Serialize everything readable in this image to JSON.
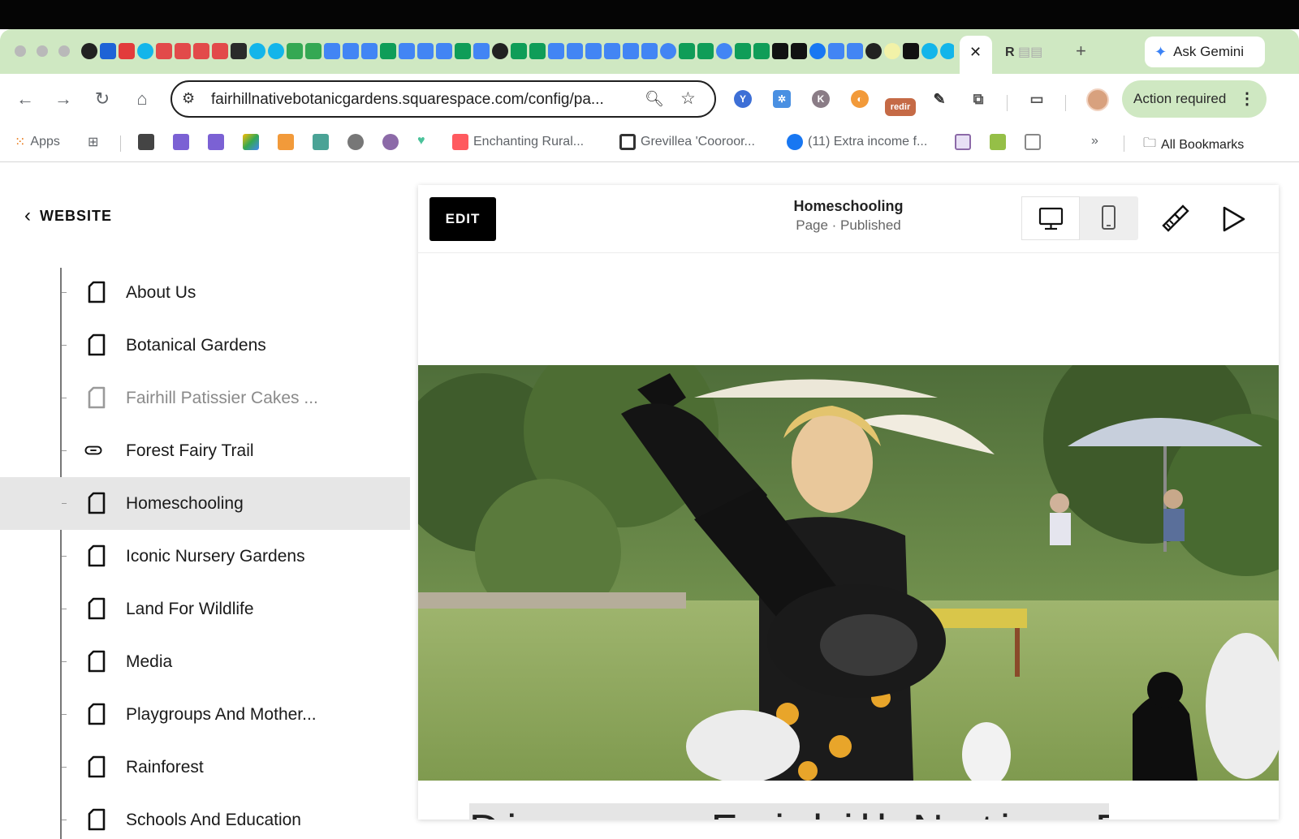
{
  "browser": {
    "address_url": "fairhillnativebotanicgardens.squarespace.com/config/pa...",
    "gemini_label": "Ask Gemini",
    "action_required_label": "Action required",
    "other_tab_label": "R",
    "bookmarks": {
      "apps_label": "Apps",
      "items": [
        "Enchanting Rural...",
        "Grevillea 'Cooroor...",
        "(11) Extra income f..."
      ],
      "all_bookmarks_label": "All Bookmarks"
    },
    "ext_redir_label": "redir"
  },
  "sidebar": {
    "back_label": "WEBSITE",
    "pages": [
      {
        "label": "About Us",
        "icon": "page-icon"
      },
      {
        "label": "Botanical Gardens",
        "icon": "page-icon"
      },
      {
        "label": "Fairhill Patissier Cakes ...",
        "icon": "page-icon",
        "disabled": true
      },
      {
        "label": "Forest Fairy Trail",
        "icon": "link-icon"
      },
      {
        "label": "Homeschooling",
        "icon": "page-icon",
        "selected": true
      },
      {
        "label": "Iconic Nursery Gardens",
        "icon": "page-icon"
      },
      {
        "label": "Land For Wildlife",
        "icon": "page-icon"
      },
      {
        "label": "Media",
        "icon": "page-icon"
      },
      {
        "label": "Playgroups And Mother...",
        "icon": "page-icon"
      },
      {
        "label": "Rainforest",
        "icon": "page-icon"
      },
      {
        "label": "Schools And Education",
        "icon": "page-icon"
      }
    ]
  },
  "editor": {
    "edit_label": "EDIT",
    "page_title": "Homeschooling",
    "page_status": "Page · Published",
    "heading_peek": "Discover Fairhill Native Botanic"
  },
  "colors": {
    "accent_green": "#cfe8c2",
    "selected_row": "#e6e6e6",
    "edit_button": "#000000"
  }
}
